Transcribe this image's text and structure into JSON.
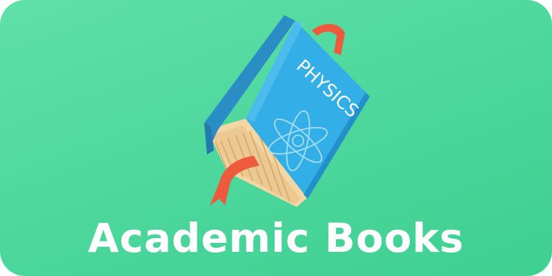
{
  "banner": {
    "title": "Academic Books",
    "book_cover_text": "PHYSICS"
  },
  "icons": {
    "book": "physics-book-icon",
    "atom": "atom-icon",
    "bookmark": "bookmark-ribbon-icon"
  },
  "colors": {
    "background": "#4fd89e",
    "title": "#ffffff",
    "book_cover": "#2fa3de",
    "book_spine": "#2a8dc4",
    "pages": "#f2d3a0",
    "ribbon": "#ee5a3c"
  }
}
